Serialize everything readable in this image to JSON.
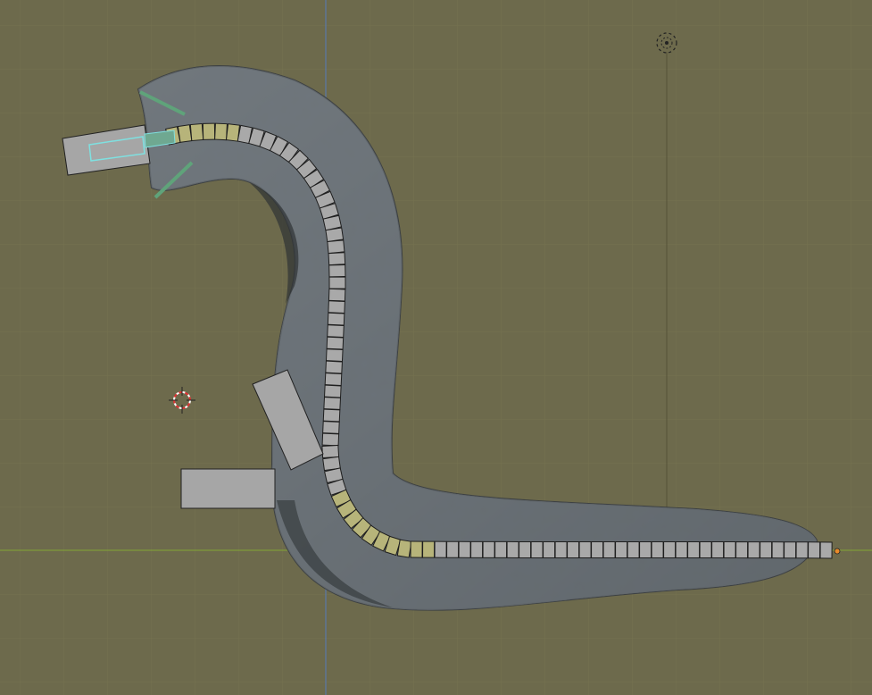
{
  "viewport": {
    "background_color": "#6d6a4c",
    "grid_color": "#75724f",
    "x_axis_color": "#7f9a3a",
    "y_axis_color": "#5a78a8",
    "tube_color": "#5e6468",
    "tube_highlight_color": "#8a9196",
    "chain_link_color": "#a9a9a9",
    "chain_selected_link_color": "#b7b47a",
    "bone_color": "#5fa37a",
    "selected_outline_color": "#7fe0e0"
  },
  "icons": {
    "light": "light-object-icon",
    "cursor": "3d-cursor-icon",
    "end_point": "curve-end-point-icon"
  }
}
